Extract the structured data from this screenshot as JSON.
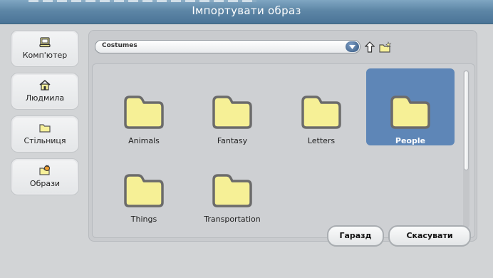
{
  "window": {
    "title": "Імпортувати образ"
  },
  "shortcuts": [
    {
      "label": "Комп'ютер",
      "icon": "computer-icon"
    },
    {
      "label": "Людмила",
      "icon": "home-icon"
    },
    {
      "label": "Стільниця",
      "icon": "folder-icon"
    },
    {
      "label": "Образи",
      "icon": "costumes-icon"
    }
  ],
  "browser": {
    "path": "Costumes",
    "items": [
      {
        "label": "Animals",
        "selected": false
      },
      {
        "label": "Fantasy",
        "selected": false
      },
      {
        "label": "Letters",
        "selected": false
      },
      {
        "label": "People",
        "selected": true
      },
      {
        "label": "Things",
        "selected": false
      },
      {
        "label": "Transportation",
        "selected": false
      }
    ]
  },
  "buttons": {
    "ok": "Гаразд",
    "cancel": "Скасувати"
  },
  "colors": {
    "titlebar": "#5d86a6",
    "selection": "#5e86b7",
    "folder": "#f6f096"
  }
}
